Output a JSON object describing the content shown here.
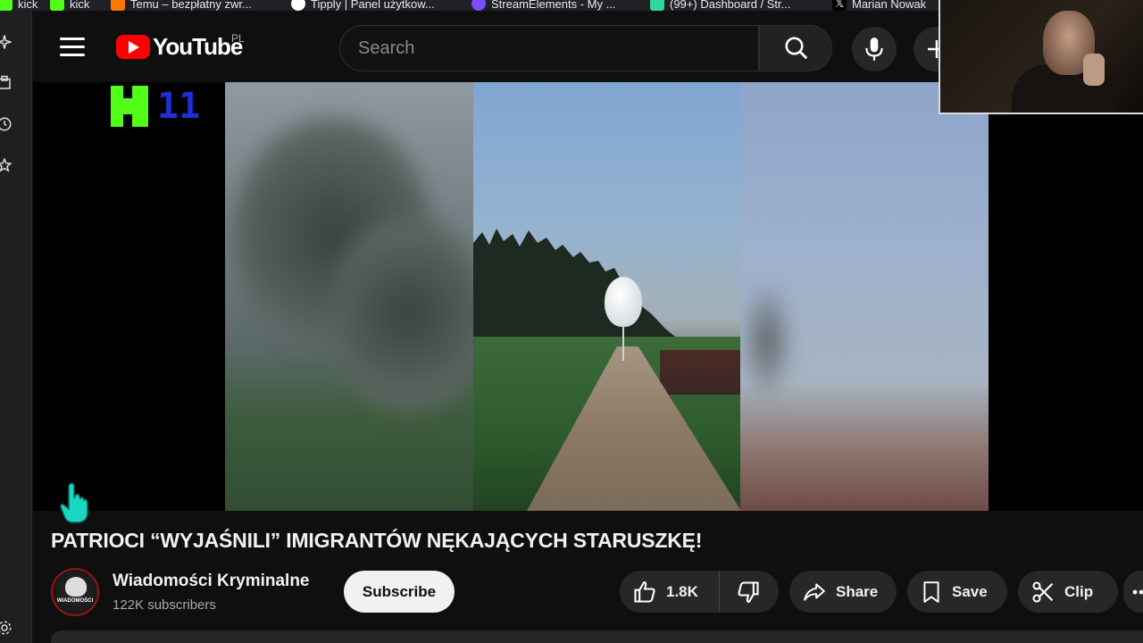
{
  "bookmarks": [
    {
      "label": "kick",
      "color": "#53fc18"
    },
    {
      "label": "kick",
      "color": "#53fc18"
    },
    {
      "label": "Temu – bezpłatny zwr...",
      "color": "#fb7701"
    },
    {
      "label": "Tipply | Panel użytkow...",
      "color": "#ffffff"
    },
    {
      "label": "StreamElements - My ...",
      "color": "#7b4dff"
    },
    {
      "label": "(99+) Dashboard / Str...",
      "color": "#2bd99f"
    },
    {
      "label": "Marian Nowak",
      "color": "#ffffff"
    }
  ],
  "header": {
    "logo_text": "YouTube",
    "country_code": "PL",
    "search_placeholder": "Search"
  },
  "player": {
    "overlay_logo_number": "11"
  },
  "video": {
    "title": "PATRIOCI “WYJAŚNILI” IMIGRANTÓW NĘKAJĄCYCH STARUSZKĘ!",
    "channel_name": "Wiadomości Kryminalne",
    "subscribers": "122K subscribers",
    "avatar_text": "WIADOMOŚCI",
    "subscribe_label": "Subscribe",
    "like_count": "1.8K",
    "share_label": "Share",
    "save_label": "Save",
    "clip_label": "Clip"
  },
  "colors": {
    "background": "#0f0f0f",
    "brand_red": "#ff0000",
    "kick_green": "#53fc18",
    "pill": "#272727"
  }
}
